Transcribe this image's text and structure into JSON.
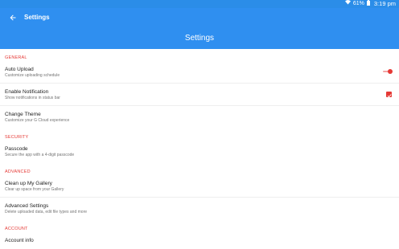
{
  "status_bar": {
    "wifi_icon": "wifi-icon",
    "battery_percent": "61%",
    "battery_icon": "battery-icon",
    "time": "3:19 pm"
  },
  "toolbar": {
    "back_icon": "arrow-back-icon",
    "title": "Settings"
  },
  "app_bar": {
    "title": "Settings"
  },
  "colors": {
    "primary": "#2f8ff0",
    "accent": "#e53935"
  },
  "sections": {
    "general": {
      "header": "GENERAL",
      "auto_upload": {
        "title": "Auto Upload",
        "summary": "Customize uploading schedule",
        "enabled": true
      },
      "enable_notification": {
        "title": "Enable Notification",
        "summary": "Show notifications in status bar",
        "checked": true
      },
      "change_theme": {
        "title": "Change Theme",
        "summary": "Customize your G Cloud experience"
      }
    },
    "security": {
      "header": "SECURITY",
      "passcode": {
        "title": "Passcode",
        "summary": "Secure the app with a 4-digit passcode"
      }
    },
    "advanced": {
      "header": "ADVANCED",
      "clean_up": {
        "title": "Clean up My Gallery",
        "summary": "Clear up space from your Gallery"
      },
      "advanced_settings": {
        "title": "Advanced Settings",
        "summary": "Delete uploaded data, edit file types and more"
      }
    },
    "account": {
      "header": "ACCOUNT",
      "account_info": {
        "title": "Account info"
      }
    }
  }
}
